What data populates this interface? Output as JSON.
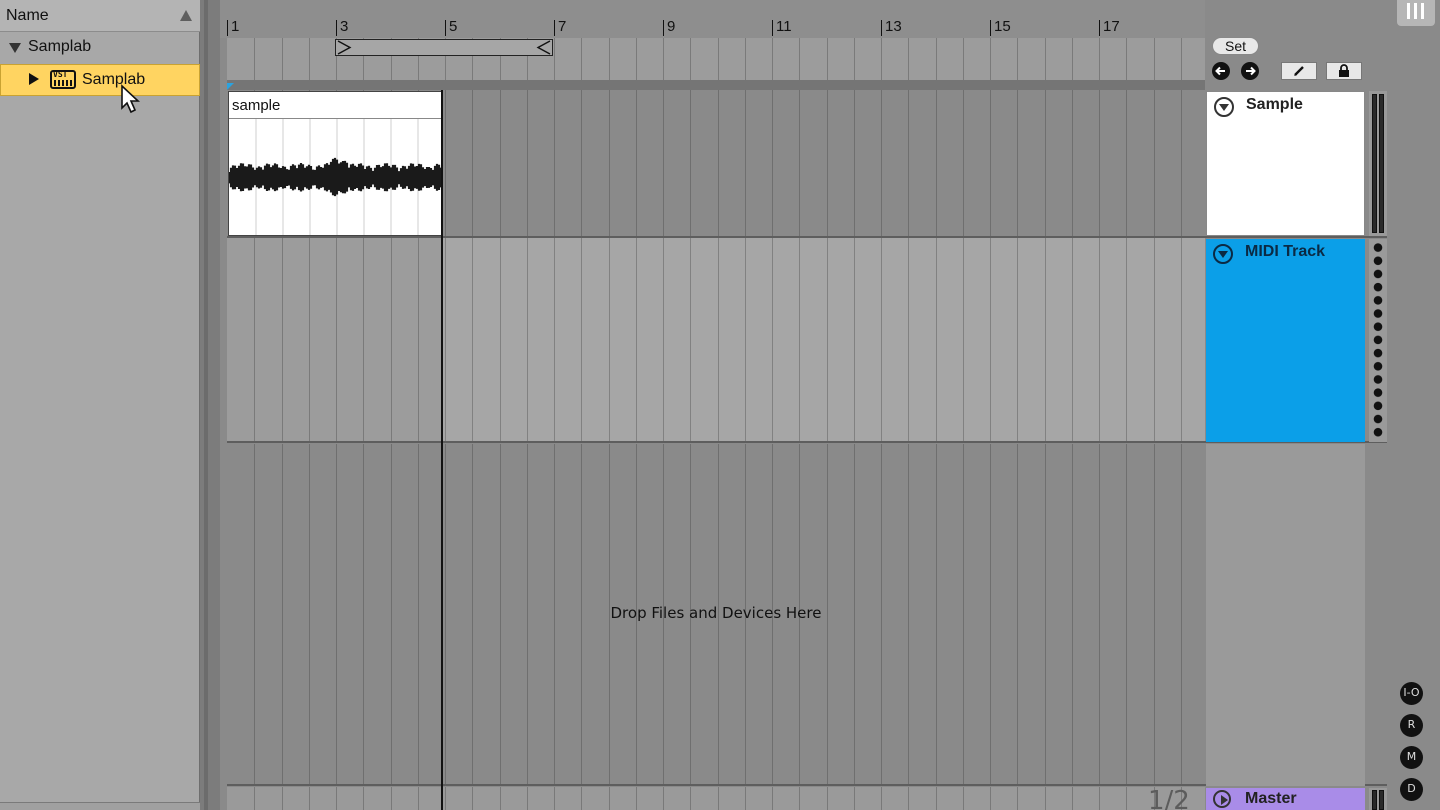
{
  "browser": {
    "header": "Name",
    "items": [
      {
        "label": "Samplab",
        "expanded": true
      },
      {
        "label": "Samplab",
        "selected": true,
        "icon": "vst-plugin-icon",
        "icon_text": "VST"
      }
    ]
  },
  "ruler": {
    "labels": [
      "1",
      "3",
      "5",
      "7",
      "9",
      "11",
      "13",
      "15",
      "17"
    ]
  },
  "arrangement": {
    "clip_name": "sample",
    "drop_hint": "Drop Files and Devices Here",
    "page_indicator": "1/2"
  },
  "controls": {
    "set_label": "Set",
    "prev_icon": "arrow-left-icon",
    "next_icon": "arrow-right-icon",
    "pencil_icon": "pencil-icon",
    "lock_icon": "lock-icon"
  },
  "tracks": [
    {
      "name": "Sample",
      "color": "#ffffff"
    },
    {
      "name": "MIDI Track",
      "color": "#0b9fe8"
    },
    {
      "name": "Master",
      "color": "#a98ce8"
    }
  ],
  "side_buttons": [
    "I-O",
    "R",
    "M",
    "D"
  ]
}
